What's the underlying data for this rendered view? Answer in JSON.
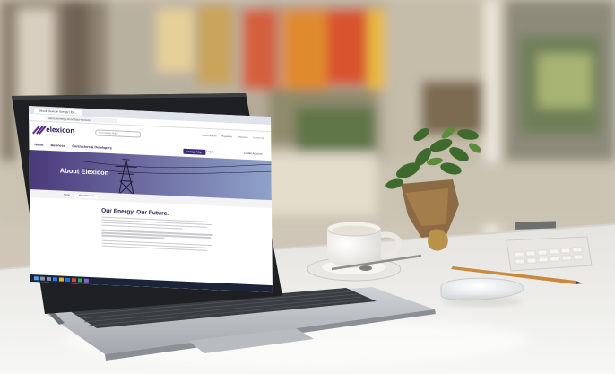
{
  "screen": {
    "tab_title": "About Elexicon Energy | Ele...",
    "url": "elexiconenergy.com/about-elexicon",
    "brand_name": "elexicon",
    "brand_sub": "ENERGY",
    "search_placeholder": "How can we help?",
    "top_links": [
      "About Elexicon",
      "Regulatory",
      "Newsroom",
      "Contact Us"
    ],
    "nav": [
      "Home",
      "Business",
      "Contractors & Developers"
    ],
    "cta_button": "Outage Map",
    "login_link": "Log in",
    "create_account_link": "Create Account",
    "hero_title": "About Elexicon",
    "breadcrumb": [
      "Home",
      "About Elexicon"
    ],
    "heading": "Our Energy. Our Future.",
    "brand_color": "#3d2a7a"
  }
}
